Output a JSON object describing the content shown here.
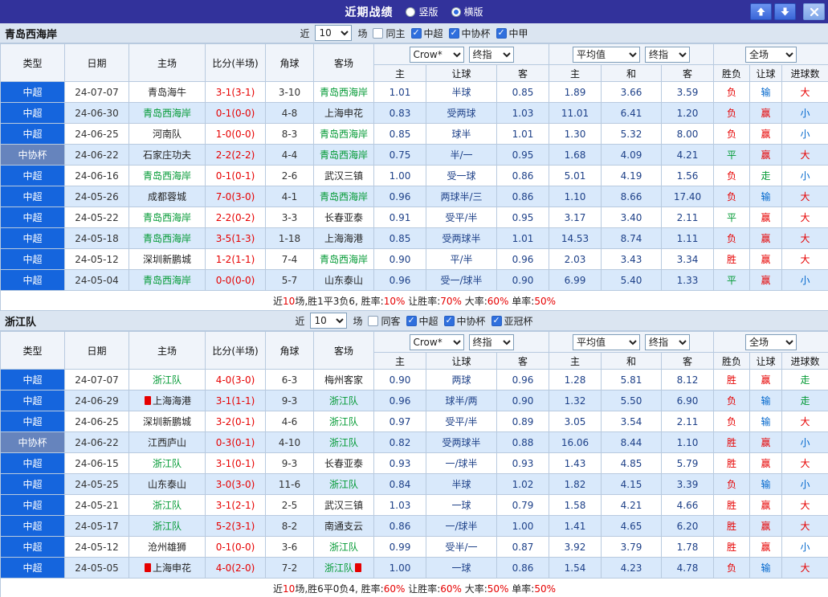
{
  "titlebar": {
    "title": "近期战绩",
    "radios": [
      {
        "label": "竖版",
        "checked": false
      },
      {
        "label": "横版",
        "checked": true
      }
    ],
    "button_icons": {
      "up": "up-arrow-icon",
      "down": "down-arrow-icon",
      "close": "close-icon"
    }
  },
  "colors": {
    "accent_bar": "#32329b",
    "league_cell": "#1565dd",
    "cup_cell": "#6684bd",
    "highlight_team": "#009933",
    "score": "#e60000",
    "win_loss": "#e60000",
    "push": "#009933",
    "under": "#0066cc",
    "alt_row": "#d9e9fb"
  },
  "table_header": {
    "type": "类型",
    "date": "日期",
    "home": "主场",
    "score": "比分(半场)",
    "corners": "角球",
    "away": "客场",
    "asian_home": "主",
    "handicap": "让球",
    "asian_away": "客",
    "euro_home": "主",
    "euro_draw": "和",
    "euro_away": "客",
    "result": "胜负",
    "handicap_result": "让球",
    "goals": "进球数",
    "selects": {
      "bookmaker": "Crow*",
      "final_a": "终指",
      "average": "平均值",
      "final_e": "终指",
      "scope": "全场"
    }
  },
  "sections": [
    {
      "team": "青岛西海岸",
      "filter": {
        "near": "近",
        "count": "10",
        "games": "场",
        "same": {
          "label": "同主",
          "checked": false
        },
        "leagues": [
          {
            "label": "中超",
            "checked": true
          },
          {
            "label": "中协杯",
            "checked": true
          },
          {
            "label": "中甲",
            "checked": true
          }
        ]
      },
      "rows": [
        {
          "type": "中超",
          "cup": false,
          "date": "24-07-07",
          "home": {
            "n": "青岛海牛"
          },
          "score": "3-1(3-1)",
          "corners": "3-10",
          "away": {
            "n": "青岛西海岸",
            "g": true
          },
          "ah": "1.01",
          "hc": "半球",
          "aa": "0.85",
          "eh": "1.89",
          "ed": "3.66",
          "ea": "3.59",
          "res": [
            "负",
            "r"
          ],
          "hres": [
            "输",
            "b"
          ],
          "gres": [
            "大",
            "r"
          ]
        },
        {
          "type": "中超",
          "cup": false,
          "date": "24-06-30",
          "home": {
            "n": "青岛西海岸",
            "g": true
          },
          "score": "0-1(0-0)",
          "corners": "4-8",
          "away": {
            "n": "上海申花"
          },
          "ah": "0.83",
          "hc": "受两球",
          "aa": "1.03",
          "eh": "11.01",
          "ed": "6.41",
          "ea": "1.20",
          "res": [
            "负",
            "r"
          ],
          "hres": [
            "赢",
            "r"
          ],
          "gres": [
            "小",
            "b"
          ]
        },
        {
          "type": "中超",
          "cup": false,
          "date": "24-06-25",
          "home": {
            "n": "河南队"
          },
          "score": "1-0(0-0)",
          "corners": "8-3",
          "away": {
            "n": "青岛西海岸",
            "g": true
          },
          "ah": "0.85",
          "hc": "球半",
          "aa": "1.01",
          "eh": "1.30",
          "ed": "5.32",
          "ea": "8.00",
          "res": [
            "负",
            "r"
          ],
          "hres": [
            "赢",
            "r"
          ],
          "gres": [
            "小",
            "b"
          ]
        },
        {
          "type": "中协杯",
          "cup": true,
          "date": "24-06-22",
          "home": {
            "n": "石家庄功夫"
          },
          "score": "2-2(2-2)",
          "corners": "4-4",
          "away": {
            "n": "青岛西海岸",
            "g": true
          },
          "ah": "0.75",
          "hc": "半/一",
          "aa": "0.95",
          "eh": "1.68",
          "ed": "4.09",
          "ea": "4.21",
          "res": [
            "平",
            "g"
          ],
          "hres": [
            "赢",
            "r"
          ],
          "gres": [
            "大",
            "r"
          ]
        },
        {
          "type": "中超",
          "cup": false,
          "date": "24-06-16",
          "home": {
            "n": "青岛西海岸",
            "g": true
          },
          "score": "0-1(0-1)",
          "corners": "2-6",
          "away": {
            "n": "武汉三镇"
          },
          "ah": "1.00",
          "hc": "受一球",
          "aa": "0.86",
          "eh": "5.01",
          "ed": "4.19",
          "ea": "1.56",
          "res": [
            "负",
            "r"
          ],
          "hres": [
            "走",
            "g"
          ],
          "gres": [
            "小",
            "b"
          ]
        },
        {
          "type": "中超",
          "cup": false,
          "date": "24-05-26",
          "home": {
            "n": "成都蓉城"
          },
          "score": "7-0(3-0)",
          "corners": "4-1",
          "away": {
            "n": "青岛西海岸",
            "g": true
          },
          "ah": "0.96",
          "hc": "两球半/三",
          "aa": "0.86",
          "eh": "1.10",
          "ed": "8.66",
          "ea": "17.40",
          "res": [
            "负",
            "r"
          ],
          "hres": [
            "输",
            "b"
          ],
          "gres": [
            "大",
            "r"
          ]
        },
        {
          "type": "中超",
          "cup": false,
          "date": "24-05-22",
          "home": {
            "n": "青岛西海岸",
            "g": true
          },
          "score": "2-2(0-2)",
          "corners": "3-3",
          "away": {
            "n": "长春亚泰"
          },
          "ah": "0.91",
          "hc": "受平/半",
          "aa": "0.95",
          "eh": "3.17",
          "ed": "3.40",
          "ea": "2.11",
          "res": [
            "平",
            "g"
          ],
          "hres": [
            "赢",
            "r"
          ],
          "gres": [
            "大",
            "r"
          ]
        },
        {
          "type": "中超",
          "cup": false,
          "date": "24-05-18",
          "home": {
            "n": "青岛西海岸",
            "g": true
          },
          "score": "3-5(1-3)",
          "corners": "1-18",
          "away": {
            "n": "上海海港"
          },
          "ah": "0.85",
          "hc": "受两球半",
          "aa": "1.01",
          "eh": "14.53",
          "ed": "8.74",
          "ea": "1.11",
          "res": [
            "负",
            "r"
          ],
          "hres": [
            "赢",
            "r"
          ],
          "gres": [
            "大",
            "r"
          ]
        },
        {
          "type": "中超",
          "cup": false,
          "date": "24-05-12",
          "home": {
            "n": "深圳新鹏城"
          },
          "score": "1-2(1-1)",
          "corners": "7-4",
          "away": {
            "n": "青岛西海岸",
            "g": true
          },
          "ah": "0.90",
          "hc": "平/半",
          "aa": "0.96",
          "eh": "2.03",
          "ed": "3.43",
          "ea": "3.34",
          "res": [
            "胜",
            "r"
          ],
          "hres": [
            "赢",
            "r"
          ],
          "gres": [
            "大",
            "r"
          ]
        },
        {
          "type": "中超",
          "cup": false,
          "date": "24-05-04",
          "home": {
            "n": "青岛西海岸",
            "g": true
          },
          "score": "0-0(0-0)",
          "corners": "5-7",
          "away": {
            "n": "山东泰山"
          },
          "ah": "0.96",
          "hc": "受一/球半",
          "aa": "0.90",
          "eh": "6.99",
          "ed": "5.40",
          "ea": "1.33",
          "res": [
            "平",
            "g"
          ],
          "hres": [
            "赢",
            "r"
          ],
          "gres": [
            "小",
            "b"
          ]
        }
      ],
      "footer": [
        [
          "近",
          "k"
        ],
        [
          "10",
          "r"
        ],
        [
          "场,胜1平3负6, 胜率:",
          "k"
        ],
        [
          "10%",
          "r"
        ],
        [
          " 让胜率:",
          "k"
        ],
        [
          "70%",
          "r"
        ],
        [
          " 大率:",
          "k"
        ],
        [
          "60%",
          "r"
        ],
        [
          " 单率:",
          "k"
        ],
        [
          "50%",
          "r"
        ]
      ]
    },
    {
      "team": "浙江队",
      "filter": {
        "near": "近",
        "count": "10",
        "games": "场",
        "same": {
          "label": "同客",
          "checked": false
        },
        "leagues": [
          {
            "label": "中超",
            "checked": true
          },
          {
            "label": "中协杯",
            "checked": true
          },
          {
            "label": "亚冠杯",
            "checked": true
          }
        ]
      },
      "rows": [
        {
          "type": "中超",
          "cup": false,
          "date": "24-07-07",
          "home": {
            "n": "浙江队",
            "g": true
          },
          "score": "4-0(3-0)",
          "corners": "6-3",
          "away": {
            "n": "梅州客家"
          },
          "ah": "0.90",
          "hc": "两球",
          "aa": "0.96",
          "eh": "1.28",
          "ed": "5.81",
          "ea": "8.12",
          "res": [
            "胜",
            "r"
          ],
          "hres": [
            "赢",
            "r"
          ],
          "gres": [
            "走",
            "g"
          ]
        },
        {
          "type": "中超",
          "cup": false,
          "date": "24-06-29",
          "home": {
            "n": "上海海港",
            "rc": "before"
          },
          "score": "3-1(1-1)",
          "corners": "9-3",
          "away": {
            "n": "浙江队",
            "g": true
          },
          "ah": "0.96",
          "hc": "球半/两",
          "aa": "0.90",
          "eh": "1.32",
          "ed": "5.50",
          "ea": "6.90",
          "res": [
            "负",
            "r"
          ],
          "hres": [
            "输",
            "b"
          ],
          "gres": [
            "走",
            "g"
          ]
        },
        {
          "type": "中超",
          "cup": false,
          "date": "24-06-25",
          "home": {
            "n": "深圳新鹏城"
          },
          "score": "3-2(0-1)",
          "corners": "4-6",
          "away": {
            "n": "浙江队",
            "g": true
          },
          "ah": "0.97",
          "hc": "受平/半",
          "aa": "0.89",
          "eh": "3.05",
          "ed": "3.54",
          "ea": "2.11",
          "res": [
            "负",
            "r"
          ],
          "hres": [
            "输",
            "b"
          ],
          "gres": [
            "大",
            "r"
          ]
        },
        {
          "type": "中协杯",
          "cup": true,
          "date": "24-06-22",
          "home": {
            "n": "江西庐山"
          },
          "score": "0-3(0-1)",
          "corners": "4-10",
          "away": {
            "n": "浙江队",
            "g": true
          },
          "ah": "0.82",
          "hc": "受两球半",
          "aa": "0.88",
          "eh": "16.06",
          "ed": "8.44",
          "ea": "1.10",
          "res": [
            "胜",
            "r"
          ],
          "hres": [
            "赢",
            "r"
          ],
          "gres": [
            "小",
            "b"
          ]
        },
        {
          "type": "中超",
          "cup": false,
          "date": "24-06-15",
          "home": {
            "n": "浙江队",
            "g": true
          },
          "score": "3-1(0-1)",
          "corners": "9-3",
          "away": {
            "n": "长春亚泰"
          },
          "ah": "0.93",
          "hc": "一/球半",
          "aa": "0.93",
          "eh": "1.43",
          "ed": "4.85",
          "ea": "5.79",
          "res": [
            "胜",
            "r"
          ],
          "hres": [
            "赢",
            "r"
          ],
          "gres": [
            "大",
            "r"
          ]
        },
        {
          "type": "中超",
          "cup": false,
          "date": "24-05-25",
          "home": {
            "n": "山东泰山"
          },
          "score": "3-0(3-0)",
          "corners": "11-6",
          "away": {
            "n": "浙江队",
            "g": true
          },
          "ah": "0.84",
          "hc": "半球",
          "aa": "1.02",
          "eh": "1.82",
          "ed": "4.15",
          "ea": "3.39",
          "res": [
            "负",
            "r"
          ],
          "hres": [
            "输",
            "b"
          ],
          "gres": [
            "小",
            "b"
          ]
        },
        {
          "type": "中超",
          "cup": false,
          "date": "24-05-21",
          "home": {
            "n": "浙江队",
            "g": true
          },
          "score": "3-1(2-1)",
          "corners": "2-5",
          "away": {
            "n": "武汉三镇"
          },
          "ah": "1.03",
          "hc": "一球",
          "aa": "0.79",
          "eh": "1.58",
          "ed": "4.21",
          "ea": "4.66",
          "res": [
            "胜",
            "r"
          ],
          "hres": [
            "赢",
            "r"
          ],
          "gres": [
            "大",
            "r"
          ]
        },
        {
          "type": "中超",
          "cup": false,
          "date": "24-05-17",
          "home": {
            "n": "浙江队",
            "g": true
          },
          "score": "5-2(3-1)",
          "corners": "8-2",
          "away": {
            "n": "南通支云"
          },
          "ah": "0.86",
          "hc": "一/球半",
          "aa": "1.00",
          "eh": "1.41",
          "ed": "4.65",
          "ea": "6.20",
          "res": [
            "胜",
            "r"
          ],
          "hres": [
            "赢",
            "r"
          ],
          "gres": [
            "大",
            "r"
          ]
        },
        {
          "type": "中超",
          "cup": false,
          "date": "24-05-12",
          "home": {
            "n": "沧州雄狮"
          },
          "score": "0-1(0-0)",
          "corners": "3-6",
          "away": {
            "n": "浙江队",
            "g": true
          },
          "ah": "0.99",
          "hc": "受半/一",
          "aa": "0.87",
          "eh": "3.92",
          "ed": "3.79",
          "ea": "1.78",
          "res": [
            "胜",
            "r"
          ],
          "hres": [
            "赢",
            "r"
          ],
          "gres": [
            "小",
            "b"
          ]
        },
        {
          "type": "中超",
          "cup": false,
          "date": "24-05-05",
          "home": {
            "n": "上海申花",
            "rc": "before"
          },
          "score": "4-0(2-0)",
          "corners": "7-2",
          "away": {
            "n": "浙江队",
            "g": true,
            "rc": "after"
          },
          "ah": "1.00",
          "hc": "一球",
          "aa": "0.86",
          "eh": "1.54",
          "ed": "4.23",
          "ea": "4.78",
          "res": [
            "负",
            "r"
          ],
          "hres": [
            "输",
            "b"
          ],
          "gres": [
            "大",
            "r"
          ]
        }
      ],
      "footer": [
        [
          "近",
          "k"
        ],
        [
          "10",
          "r"
        ],
        [
          "场,胜6平0负4, 胜率:",
          "k"
        ],
        [
          "60%",
          "r"
        ],
        [
          " 让胜率:",
          "k"
        ],
        [
          "60%",
          "r"
        ],
        [
          " 大率:",
          "k"
        ],
        [
          "50%",
          "r"
        ],
        [
          " 单率:",
          "k"
        ],
        [
          "50%",
          "r"
        ]
      ]
    }
  ]
}
